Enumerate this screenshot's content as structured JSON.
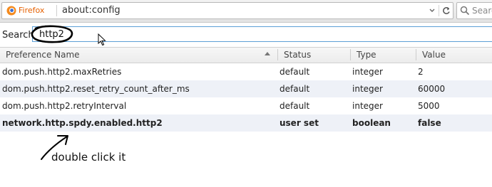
{
  "browser": {
    "brand": "Firefox",
    "url": "about:config",
    "search_placeholder": "Search"
  },
  "config": {
    "search_label": "Search:",
    "search_value": "http2",
    "columns": [
      "Preference Name",
      "Status",
      "Type",
      "Value"
    ],
    "rows": [
      {
        "name": "dom.push.http2.maxRetries",
        "status": "default",
        "type": "integer",
        "value": "2"
      },
      {
        "name": "dom.push.http2.reset_retry_count_after_ms",
        "status": "default",
        "type": "integer",
        "value": "60000"
      },
      {
        "name": "dom.push.http2.retryInterval",
        "status": "default",
        "type": "integer",
        "value": "5000"
      },
      {
        "name": "network.http.spdy.enabled.http2",
        "status": "user set",
        "type": "boolean",
        "value": "false"
      }
    ]
  },
  "annotation": {
    "note": "double click it"
  },
  "colors": {
    "firefox_brand": "#e66000",
    "row_alt": "#eef1f7",
    "input_focus_border": "#5c9fd6"
  }
}
